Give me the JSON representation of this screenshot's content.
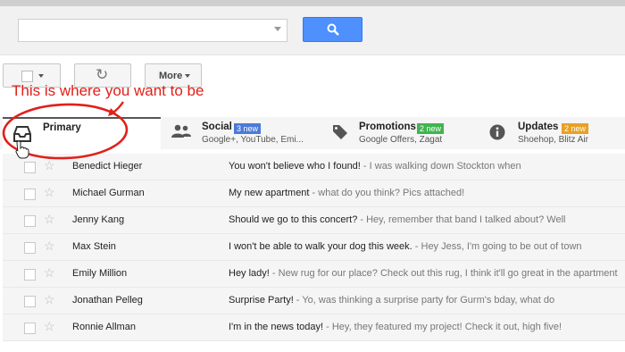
{
  "search": {
    "placeholder": ""
  },
  "toolbar": {
    "more_label": "More"
  },
  "annotation": {
    "text": "This is where you want to be"
  },
  "tabs": [
    {
      "label": "Primary",
      "sub": "",
      "badge": ""
    },
    {
      "label": "Social",
      "sub": "Google+, YouTube, Emi...",
      "badge": "3 new"
    },
    {
      "label": "Promotions",
      "sub": "Google Offers, Zagat",
      "badge": "2 new"
    },
    {
      "label": "Updates",
      "sub": "Shoehop, Blitz Air",
      "badge": "2 new"
    }
  ],
  "colors": {
    "annotation": "#e0201a",
    "social_badge": "#4a7bd8",
    "promotions_badge": "#3fb54e",
    "updates_badge": "#e8a124",
    "search_button": "#4d90fe"
  },
  "emails": [
    {
      "sender": "Benedict Hieger",
      "subject": "You won't believe who I found!",
      "snippet": " - I was walking down Stockton when"
    },
    {
      "sender": "Michael Gurman",
      "subject": "My new apartment",
      "snippet": " - what do you think? Pics attached!"
    },
    {
      "sender": "Jenny Kang",
      "subject": "Should we go to this concert?",
      "snippet": " - Hey, remember that band I talked about? Well"
    },
    {
      "sender": "Max Stein",
      "subject": "I won't be able to walk your dog this week.",
      "snippet": " - Hey Jess, I'm going to be out of town"
    },
    {
      "sender": "Emily Million",
      "subject": "Hey lady!",
      "snippet": " - New rug for our place? Check out this rug, I think it'll go great in the apartment"
    },
    {
      "sender": "Jonathan Pelleg",
      "subject": "Surprise Party!",
      "snippet": " - Yo, was thinking a surprise party for Gurm's bday, what do"
    },
    {
      "sender": "Ronnie Allman",
      "subject": "I'm in the news today!",
      "snippet": " - Hey, they featured my project! Check it out, high five!"
    }
  ]
}
